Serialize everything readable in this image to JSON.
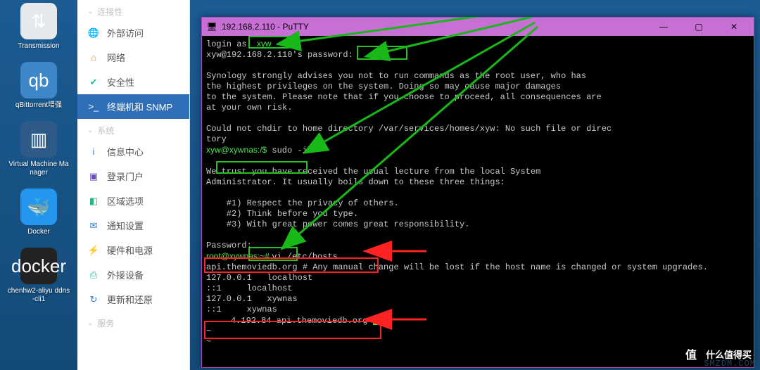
{
  "desktop": [
    {
      "name": "transmission",
      "label": "Transmission",
      "glyph": "⇅",
      "cls": "g-trans"
    },
    {
      "name": "qbittorrent",
      "label": "qBittorrent增强",
      "glyph": "qb",
      "cls": "g-qbit"
    },
    {
      "name": "vmm",
      "label": "Virtual Machine Manager",
      "glyph": "▥",
      "cls": "g-vmm"
    },
    {
      "name": "docker",
      "label": "Docker",
      "glyph": "🐳",
      "cls": "g-docker"
    },
    {
      "name": "docker2",
      "label": "chenhw2-aliyu ddns-cli1",
      "glyph": "docker",
      "cls": "g-docker2"
    }
  ],
  "sidebar": {
    "groups": [
      {
        "label": "连接性",
        "items": [
          {
            "name": "external-access",
            "label": "外部访问",
            "icon": "🌐",
            "color": "#24a5ef"
          },
          {
            "name": "network",
            "label": "网络",
            "icon": "⌂",
            "color": "#f08a3c"
          },
          {
            "name": "security",
            "label": "安全性",
            "icon": "✔",
            "color": "#19c29a"
          },
          {
            "name": "terminal-snmp",
            "label": "终端机和 SNMP",
            "icon": ">_",
            "color": "#445",
            "active": true
          }
        ]
      },
      {
        "label": "系统",
        "items": [
          {
            "name": "info-center",
            "label": "信息中心",
            "icon": "i",
            "color": "#2f7bd8"
          },
          {
            "name": "login-portal",
            "label": "登录门户",
            "icon": "▣",
            "color": "#6a4bbf"
          },
          {
            "name": "region",
            "label": "区域选项",
            "icon": "◧",
            "color": "#26b57a"
          },
          {
            "name": "notification",
            "label": "通知设置",
            "icon": "✉",
            "color": "#2f7bd8"
          },
          {
            "name": "hardware-power",
            "label": "硬件和电源",
            "icon": "⚡",
            "color": "#7a8896"
          },
          {
            "name": "external-devices",
            "label": "外接设备",
            "icon": "⎙",
            "color": "#1fb59a"
          },
          {
            "name": "update-restore",
            "label": "更新和还原",
            "icon": "↻",
            "color": "#2f7bd8"
          }
        ]
      },
      {
        "label": "服务",
        "items": []
      }
    ]
  },
  "putty": {
    "title": "192.168.2.110 - PuTTY",
    "login_as": "login as:",
    "user": "xyw",
    "pwprompt": "xyw@192.168.2.110's password:",
    "warn1": "Synology strongly advises you not to run commands as the root user, who has",
    "warn2": "the highest privileges on the system. Doing so may cause major damages",
    "warn3": "to the system. Please note that if you choose to proceed, all consequences are",
    "warn4": "at your own risk.",
    "chdir1": "Could not chdir to home directory /var/services/homes/xyw: No such file or direc",
    "chdir2": "tory",
    "prompt1": "xyw@xywnas:/$",
    "cmd1": "sudo -i",
    "trust1": "We trust you have received the usual lecture from the local System",
    "trust2": "Administrator. It usually boils down to these three things:",
    "rule1": "    #1) Respect the privacy of others.",
    "rule2": "    #2) Think before you type.",
    "rule3": "    #3) With great power comes great responsibility.",
    "pwd2": "Password:",
    "prompt2": "root@xywnas:~# ",
    "cmd2": "vi /etc/hosts",
    "hosts1": "api.themoviedb.org # Any manual change will be lost if the host name is changed or system upgrades.",
    "hosts2": "127.0.0.1   localhost",
    "hosts3": "::1     localhost",
    "hosts4": "127.0.0.1   xywnas",
    "hosts5": "::1     xywnas",
    "hosts6_ip": "   4.192.84",
    "hosts6_host": "api.themoviedb.org",
    "tilde": "~"
  },
  "watermark": {
    "brand": "什么值得买",
    "sub": "SMZDM.COM"
  }
}
